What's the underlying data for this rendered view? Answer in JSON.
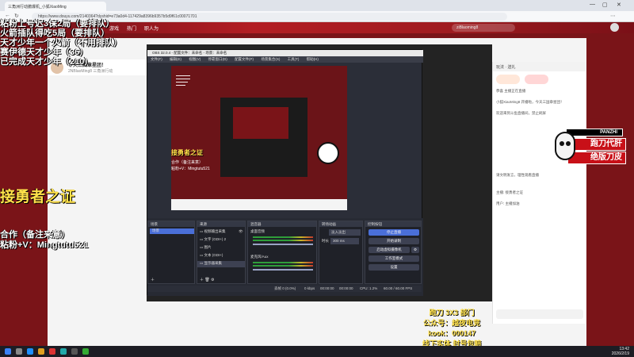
{
  "browser": {
    "tab_title": "三角洲行动撤爆机_小狐XiaoMing",
    "url": "https://www.douyu.com/2140364?dyshid=e73a0d4-117429a8396b9357b5d9f61c00071701",
    "search_placeholder": "ziBlaoming8"
  },
  "site_nav": {
    "items": [
      "游戏",
      "热门",
      "职人为"
    ]
  },
  "streamer": {
    "room_name": "今天三国章星团！",
    "meta": "2NBlaoMing8  三角洲行动"
  },
  "overlay_left": {
    "lines": [
      "粘粉上号迟3保2局（要排队）",
      "火箭插队得吃5局（要排队）",
      "天才少年一个火箭（不用排队）",
      "赛伊德天才少年（36）",
      "已完成天才少年（210）"
    ],
    "headline": "接勇者之证",
    "coop": "合作（备注来意）",
    "contact": "粘粉+V：Mingtutu521"
  },
  "obs": {
    "title": "OBS 32.0.4 - 配置文件：未命名 - 场景：未命名",
    "menu": [
      "文件(F)",
      "编辑(E)",
      "视图(V)",
      "停靠窗口(D)",
      "配置文件(P)",
      "场景集合(S)",
      "工具(T)",
      "帮助(H)"
    ],
    "preview_overlay": {
      "headline": "接勇者之证",
      "coop": "合作（备注来意）",
      "contact": "粘粉+V：Mingtutu521"
    },
    "panels": {
      "scenes": {
        "title": "场景",
        "items": [
          "场景"
        ]
      },
      "sources": {
        "title": "来源",
        "items": [
          "视频输出采集",
          "文字 (GDI+) 2",
          "图片",
          "文本 (GDI+)",
          "显示器采集"
        ]
      },
      "mixer": {
        "title": "混音器",
        "tracks": [
          "桌面音频",
          "麦克风/Aux"
        ]
      },
      "transitions": {
        "title": "转场动画",
        "type": "淡入淡出",
        "duration_label": "时长",
        "duration": "300 ms"
      },
      "controls": {
        "title": "控制按钮",
        "buttons": [
          "停止直播",
          "开始录制",
          "启动虚拟摄像机",
          "工作室模式",
          "设置"
        ]
      }
    },
    "status": [
      "丢帧 0 (0.0%)",
      "0 kbps",
      "00:00:00",
      "00:00:00",
      "CPU: 1.2%",
      "60.00 / 60.00 FPS"
    ]
  },
  "chat": {
    "header": "玩法 · 送礼",
    "messages": [
      "恭喜 主播正在直播",
      "小狐XiaoMing8 开播啦，今天三国章星团！",
      "欢迎来到斗鱼直播间，禁止刷屏",
      "请文明发言，理性观看直播",
      "主播: 接勇者之证",
      "用户: 主播加油"
    ]
  },
  "sticker": {
    "brand": "PANZHI",
    "line1": "跑刀代肝",
    "line2": "绝版刀皮"
  },
  "promo": {
    "lines": [
      "跑刀 3X3 部门",
      "公众号：越夜电竞",
      "kook：000147",
      "线下实体 封号包赔"
    ]
  },
  "taskbar": {
    "time": "13:42",
    "date": "2026/2/19"
  },
  "colors": {
    "site_red": "#b31e23",
    "obs_bg": "#2b2e38",
    "accent_yellow": "#ffe14a",
    "obs_blue": "#4a6fd8"
  }
}
